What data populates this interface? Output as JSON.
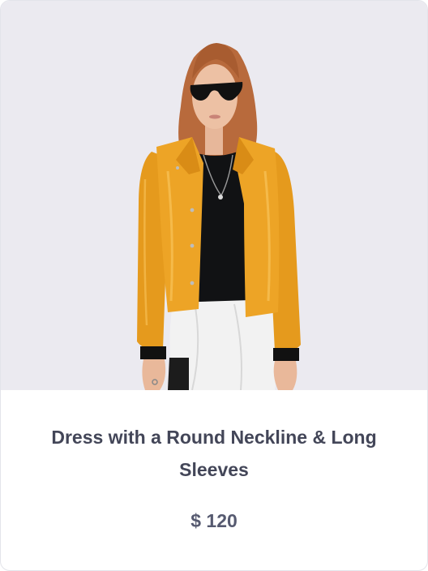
{
  "product": {
    "image_alt": "Model wearing a yellow leather jacket, black top and white skirt",
    "title": "Dress with a Round Neckline & Long Sleeves",
    "price": "$ 120"
  },
  "colors": {
    "image_background": "#ebeaf0",
    "jacket": "#e8a124",
    "title_text": "#434658",
    "price_text": "#565a70"
  }
}
